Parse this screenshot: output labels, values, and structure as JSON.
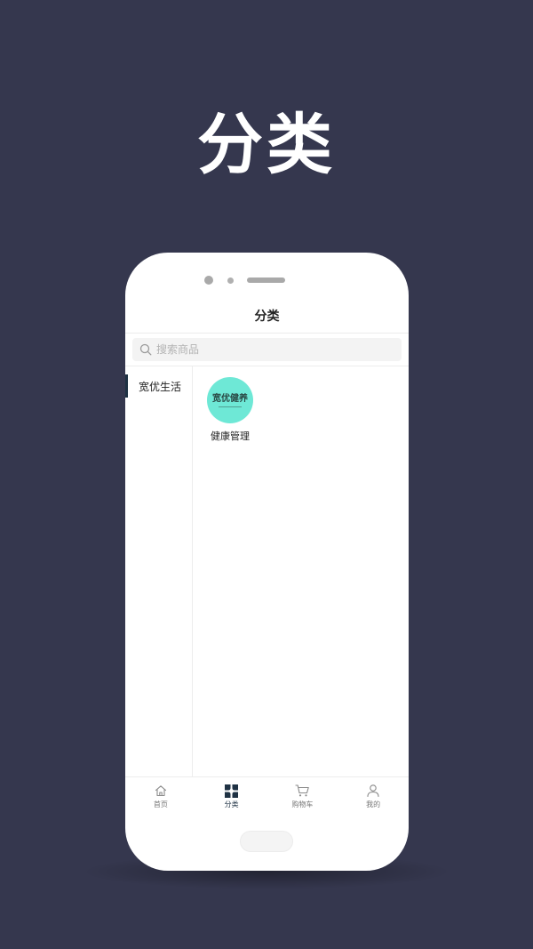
{
  "hero": {
    "title": "分类"
  },
  "screen": {
    "nav_title": "分类",
    "search": {
      "placeholder": "搜索商品",
      "icon": "search-icon"
    },
    "sidebar": {
      "items": [
        {
          "label": "宽优生活",
          "active": true
        }
      ]
    },
    "categories": [
      {
        "label": "健康管理",
        "logo_text": "宽优健养",
        "logo_color": "#6ee8d6"
      }
    ],
    "tabbar": {
      "items": [
        {
          "label": "首页",
          "icon": "home-icon",
          "active": false
        },
        {
          "label": "分类",
          "icon": "category-grid-icon",
          "active": true
        },
        {
          "label": "购物车",
          "icon": "cart-icon",
          "active": false
        },
        {
          "label": "我的",
          "icon": "user-icon",
          "active": false
        }
      ]
    }
  },
  "colors": {
    "background": "#35374e",
    "accent": "#1f3244",
    "logo_bg": "#6ee8d6"
  }
}
